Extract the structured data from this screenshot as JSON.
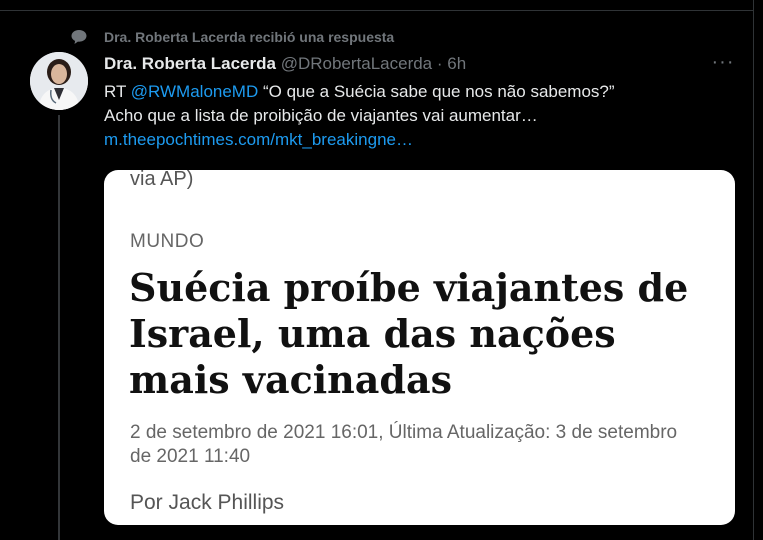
{
  "context": {
    "icon": "speech-bubble-icon",
    "text": "Dra. Roberta Lacerda recibió una respuesta"
  },
  "tweet": {
    "author_name": "Dra. Roberta Lacerda",
    "handle": "@DRobertaLacerda",
    "separator": "·",
    "time": "6h",
    "more_icon": "ellipsis-icon",
    "more_label": "···",
    "body": {
      "prefix": "RT ",
      "mention": "@RWMaloneMD",
      "quote": " “O que a Suécia sabe que nos não sabemos?”",
      "line2": "Acho que a lista de proibição de viajantes vai aumentar…",
      "link": "m.theepochtimes.com/mkt_breakingne…"
    },
    "card": {
      "via": "via AP)",
      "section": "MUNDO",
      "headline_lines": [
        "Suécia proíbe viajantes de",
        "Israel, uma das nações",
        "mais vacinadas"
      ],
      "date": "2 de setembro de 2021 16:01, Última Atualização: 3 de setembro de 2021 11:40",
      "byline": "Por Jack Phillips"
    }
  },
  "colors": {
    "background": "#000000",
    "link": "#1d9bf0",
    "muted": "#71767b",
    "text": "#e7e9ea"
  }
}
